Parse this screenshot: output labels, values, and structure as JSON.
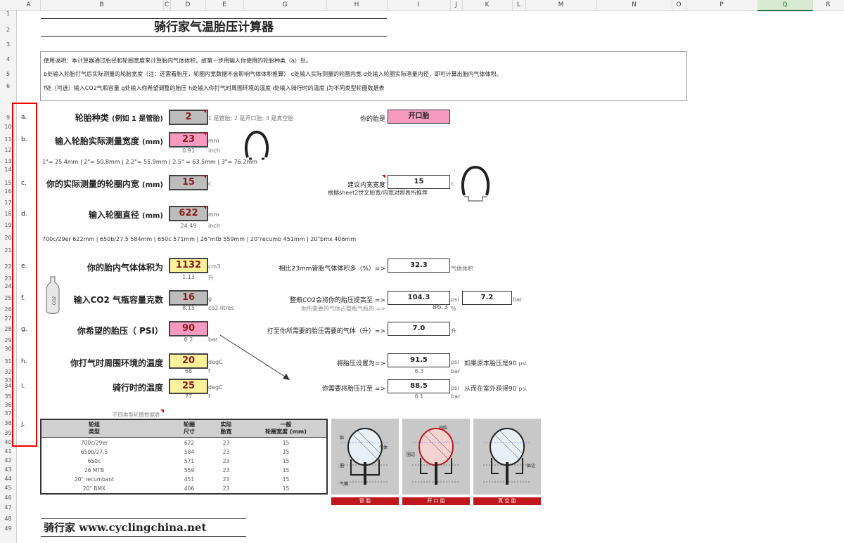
{
  "columns": [
    "A",
    "B",
    "C",
    "D",
    "E",
    "G",
    "H",
    "I",
    "J",
    "K",
    "L",
    "M",
    "N",
    "O",
    "P",
    "Q",
    "R"
  ],
  "rows": [
    "1",
    "2",
    "3",
    "4",
    "5",
    "6",
    "9",
    "10",
    "11",
    "12",
    "13",
    "14",
    "15",
    "16",
    "17",
    "18",
    "19",
    "20",
    "21",
    "22",
    "23",
    "24",
    "25",
    "26",
    "27",
    "28",
    "29",
    "30",
    "31",
    "32",
    "33",
    "34",
    "35",
    "36",
    "37",
    "38",
    "39",
    "40",
    "41",
    "42",
    "43",
    "44",
    "45",
    "46",
    "47",
    "48",
    "49"
  ],
  "title": "骑行家气温胎压计算器",
  "instructions": [
    "使用说明：本计算器通过胎径和轮圈宽度来计算胎内气体体积，故第一步用输入你使用的轮胎种类（a）处。",
    "b处输入轮胎打气后实际测量的轮胎宽度（注：还需看胎压，轮圈内宽数据不会影响气体体积推算）  c处输入实际测量的轮圈内宽 d处输入轮圈实际测量内径，即可计算出胎内气体体积。",
    "f处（可选）输入CO2气瓶容量  g处输入你希望调整的胎压  h处输入你打气时周围环境的温度  i处输入骑行时的温度  j为不同类型轮圈数据表"
  ],
  "row_letters": [
    "a.",
    "b.",
    "c.",
    "d.",
    "e.",
    "f.",
    "g.",
    "h.",
    "i.",
    "j."
  ],
  "a": {
    "label": "轮胎种类",
    "label_small": "(例如 1 是管胎)",
    "value": "2",
    "note": "1 是管胎; 2 是开口胎; 3 是真空胎",
    "result_label": "你的胎是",
    "result": "开口胎"
  },
  "b": {
    "label": "输入轮胎实际测量宽度",
    "unit_paren": "(mm)",
    "value": "23",
    "unit": "mm",
    "sub": "0.91",
    "sub_unit": "inch",
    "conv": "1\"= 25.4mm | 2\"= 50.8mm | 2.2\"= 55.9mm | 2.5\" = 63.5mm | 3\"= 76.2mm"
  },
  "c": {
    "label": "你的实际测量的轮圈内宽",
    "unit_paren": "(mm)",
    "value": "15",
    "unit": "c",
    "rec_label": "建议内宽宽度",
    "rec_value": "15",
    "rec_unit": "c",
    "rec_note": "根据sheet2世文胎宽/内宽对照表所推荐"
  },
  "d": {
    "label": "输入轮圈直径",
    "unit_paren": "(mm)",
    "value": "622",
    "unit": "mm",
    "sub": "24.49",
    "sub_unit": "inch",
    "sizes": "700c/29er 622mm | 650b/27.5 584mm | 650c 571mm | 26\"mtb 559mm | 20\"recumb 451mm | 20\"bmx 406mm"
  },
  "e": {
    "label": "你的胎内气体体积为",
    "value": "1132",
    "unit": "cm3",
    "sub": "1.13",
    "sub_unit": "升",
    "cmp_label": "相比23mm管胎气体体积多（%）=>",
    "cmp_value": "32.3",
    "cmp_unit": "气体体积"
  },
  "f": {
    "label": "输入CO2 气瓶容量克数",
    "value": "16",
    "unit": "g",
    "sub": "8.15",
    "sub_unit": "co2 litres",
    "co2_label": "整瓶CO2会将你的胎压提高至 =>",
    "co2_psi": "104.3",
    "psi_unit": "psi",
    "co2_bar": "7.2",
    "bar_unit": "bar",
    "pct_label": "你所需要的气体占整瓶气瓶的 =>",
    "pct_value": "86.3",
    "pct_unit": "%"
  },
  "g": {
    "label": "你希望的胎压（ PSI）",
    "value": "90",
    "sub": "6.2",
    "sub_unit": "bar",
    "need_label": "打至你所需要的胎压需要的气体（升）=>",
    "need_value": "7.0",
    "need_unit": "升"
  },
  "h": {
    "label": "你打气时周围环境的温度",
    "value": "20",
    "unit": "degC",
    "sub": "68",
    "sub_unit": "f",
    "set_label": "将胎压设置为=>",
    "set_value": "91.5",
    "set_unit": "psi",
    "set_sub": "6.3",
    "set_sub_unit": "bar",
    "set_note": "如果原本胎压是90",
    "set_note_unit": "psi"
  },
  "i": {
    "label": "骑行时的温度",
    "value": "25",
    "unit": "degC",
    "sub": "77",
    "sub_unit": "f",
    "ride_label": "你需要将胎压打至 =>",
    "ride_value": "88.5",
    "ride_unit": "psi",
    "ride_sub": "6.1",
    "ride_sub_unit": "bar",
    "ride_note": "从而在室外获得90",
    "ride_note_unit": "psi"
  },
  "table_note": "不同类型轮圈数据表",
  "table": {
    "headers": [
      [
        "轮组",
        "类型"
      ],
      [
        "轮圈",
        "尺寸"
      ],
      [
        "实际",
        "胎宽"
      ],
      [
        "一般",
        "轮圈宽度 (mm)"
      ]
    ],
    "rows": [
      [
        "700c/29er",
        "622",
        "23",
        "15"
      ],
      [
        "650b/27.5",
        "584",
        "23",
        "15"
      ],
      [
        "650c",
        "571",
        "23",
        "15"
      ],
      [
        "26 MTB",
        "559",
        "23",
        "15"
      ],
      [
        "20\" recumbant",
        "451",
        "23",
        "15"
      ],
      [
        "20\" BMX",
        "406",
        "23",
        "15"
      ]
    ]
  },
  "diagram": {
    "labels1": [
      "胎",
      "气体",
      "圈",
      "气嘴"
    ],
    "labels2": [
      "内胎",
      "圈边"
    ],
    "labels3": [
      "胎边"
    ],
    "bars": [
      "管 胎",
      "开 口 胎",
      "真 空 胎"
    ]
  },
  "website": "骑行家 www.cyclingchina.net",
  "colors": {
    "pink": "#f79ac0",
    "yellow": "#fbf29b",
    "gray": "#bdbdbd",
    "red": "#c0171c"
  }
}
